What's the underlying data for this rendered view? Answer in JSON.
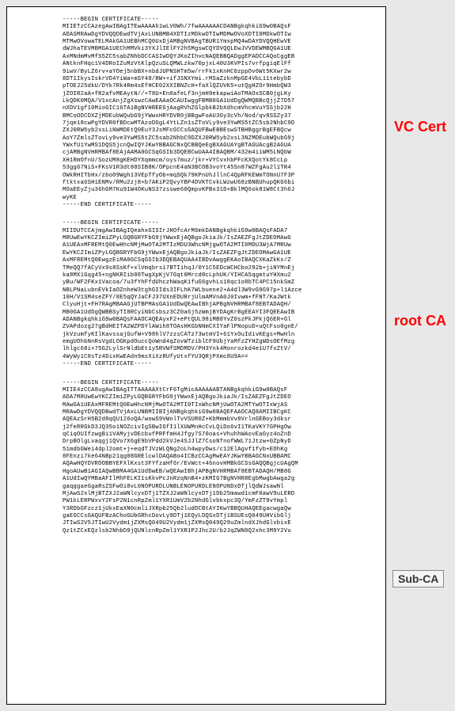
{
  "labels": {
    "vc": "VC Cert",
    "root": "root CA",
    "sub": "Sub-CA"
  },
  "certs": {
    "block1": "-----BEGIN CERTIFICATE-----\nMIIETzCCAzegAwIBAgITEwAAAAh1wLV0Wh/7fwAAAAAACDANBgkqhkiG9w0BAQsF\nADASMRAwDgYDVQQDEwdTVjAxLUNBMB4XDTIzMDkwOTIwMDMwOVoXDTI0MDkwOTIw\nMTMwOVowaTELMAkGA1UEBhMCQ0UxDjAMBgNVBAgTBUR1YmxpMQ4wDAYDVQQHEwVE\ndWJhaTEVMBMGA1UEChMMVki3YXJlIElFY2h5MgswCQYDVQQLEwJVVDEWMBQGA1UE\nAxMNdmMvMfS5ZC5sabZNhbDCCASIwDQYJKoZIhvcNAQEBBQADggEPADCCAQoCggEB\nANtknFHqc1V4DRoIZuMzVtKlpQzuSLQMWLzkw70pjxL40U3KVPIs7vrfpgiqElFf\n9iwV/ByLZ6rv+aYOej5nbBX+nbdJUPNSHTm5w/rrFk1xKnHC0zppOv6Wt5KXwr2w\n8DT1IkysIskrVD4YiWa+mSY48/RW++ifJSNXYmi.rMSaZzknMpGE4VbL11tebybD\npTOEJ25dkU/DYk7Rk4Rm4sEfHCE02XXIBNZcH+faXlQZUVK5+utQgHZOr9HmbQW3\njZOIR2aA+fR2afvMEAytN//+T8U+En0afeLf3njmH9ekapwiAoTMAOxSCB0jgLKy\nLkQDK0MQA/V1xcAnjZgXswzCAwEAAaOCAUIwggFBMB0GA1UdDgQWMQBBcQjjZ7D57\nnXDV1gf10MioGIC16TA1BgNVHREEGjAagRVhZGlpbkB2bXdhcmVhcmVuYSSjb22H\nBMCoODCDXZjMDEubWQubG9jYWwxHRYDVR0jBBgwFoAU3Gy3cVh/Nod/qv8SSZy37\n7jqe18cwPgYDVR0fBDcwMTAzoDGgL4YtLZn1sZToVLy9ve3YwMS5tZC5sb2NhbC9D\nZXJ0RW5yb2xsLiNWMDEtQ0EuY3JsMFcGCCsGAQUFBwEBBEswSTBHBggrBgEFBQcw\nAoY7ZmlsZTovLy9ve3YwMS5tZC5sab2NhbC9DZXJ0RW5yb2xsL3NZMDEubWQubG9j\nYWxfU1YwMS1DQS5jcnQwIQYJKwYBBAGCNxQCBBQeEgBXAGUAYgBTAGUAcgB2AGUA\ncjAMBgNVHRMBAf8EAjAAMA0GCSqGSIb3DQEBCwUAA4IBAQBM/432m4iiWM5LNQbW\nXH1RmOfnU/SozUM8gKEHDYXqmmcm/oys7muz/jkr+VYCvxhbPFcKXQotYk8CcLp\n53gg67NiS+FKsV1R3dt80SIB8K/OPpcnE4aN3BCOB3voYt45Sn87WZFgAu2l1TR4\nOWkRHITbHx/zboO9Wgh13VEpTfyOb+mqSQk79KPnUhJllnC4QpRFKEWmTONnU7F3P\nftktxa6SH1ENMv/RMu2zj8+b7AKiP2QvyYBP4DVKTCvkLWzwU68zBNBUhupQKG6bi\nMOaEEyZju36hGM7Ku91W4OKuNS37zsswe60QmpvKPBx31D+BklMQ6ok81W8Ct3h6J\nwyKE\n-----END CERTIFICATE-----",
    "block2": "-----BEGIN CERTIFICATE-----\nMIIDUTCCAjmgAwIBAgIQeahxGISIrJHOfcArM6mkDANBgkqhkiG9w0BAQsFADA7\nMRUwEwYKCZImiZPyLGQBGRYFbG9jYWwxEjAQBgoJkiaJk/IsZAEZFgJtZDEOMAwG\nA1UEAxMFREMtQ0EwHhcNMjMwOTA2MTIzMDU3WhcNMjgwOTA2MTI0MDU3WjA7MRUw\nEwYKCZImiZPyLGQBGRYFbG9jYWwxEjAQBgoJkiaJk/IsZAEZFgJtZDEOMAwGA1UE\nAxMFREMtQ0EwgzEiMA0GCSqGSIb3DQEBAQUAA4IBDvAwggEKAoIBAQCXKaZkKx/Z\nTMeQQ7fACyVx9s8SsKf+xlVmqbrsi7BTIihqJ/0Y1C5EDcWCHCbo292b+jiNYMnEj\nka8MX1Gqg45+ngNKRIib08TwgXpKjV7Gqt0Mrcd8cLphUK/YIHCA5qgmtuYHXmu2\nyBu/WF2FKx1Vacoa/7u3fYhFfdUhczhWaqK1fuG6gvhLs18qc1o8bTC4PC15nkSmZ\nNBLPNaLubnEVkIaOZnheW3tghGIIds3IFLhK7WLbuene2+A4dl3W9vG9G97p+l1Azce\n10H/V1SM4seZFY/8E5qQYJaCFJ37UXnEDURrjUlmAMVnA0J0Ivwm+fFNT/KaJWtk\nClyuHjt+FH7RAgMBAAGjUTBPMAsGA1UdDwQEAwIBhjAPBgNVHRMBAf8EBTADAQH/\nMB0GA1UdDgQWBBSyTI8RCyiNbCsbsz3CZ0a6j5zWmjBYDAgKrBgEEAYI3FQEEAwIB\nADANBgkqhkiG9w0BAQsFAAOCAQEAyxF2+ePtQUL98iMB8YvZ0szPkJPkjQ6ER+Gl\nZVAPdozg27gBdHEITA2WZPDYlAWih8TOAsHKGbNNmCXIYaFlPNopuD+uQtFso0gnE/\njkVzumfyKIlKavssajGufW+V98hlV7zzsCATz73wtmVI+61YxOuIdivKEgs+MwHln\nemgUOhbNnRsVgdLOGKpdOuccQoWnd4qZovWTziblCF9UbjYaMfzZYHZgWDsOEfMzg\nlhlgc68i+75G2LylSrNldbEt1y5RVWfSMDMDV/PH3Ynk4Monrozkd4e1U7fxZtV/\n4WyWy1C8sTz4DixKwEAdn9msXiXzRUfyUtxfYU3QRjPXmc8U9A==\n-----END CERTIFICATE-----",
    "block3": "-----BEGIN CERTIFICATE-----\nMIIE4zCCA8ugAwIBAgITTAAAAAXtCrF6TgMicAAAAAABTANBgkqhkiG9w0BAQsF\nADA7MRUwEwYKCZImiZPyLGQBGRYFbG9jYWwxEjAQBgoJkiaJk/IsZAEZFgJtZDEO\nMAwGA1UEAxMFREMtQ0EwHhcNMjMwOTA2MTI0TIxWhcNMjUwOTA2MTYwOTIxWjAS\nMRAwDgYDVQQDBwdTVjAxLUNBMIIBIjANBgkqhkiG9w0BAQEFAAOCAQ8AMIIBCgKC\nAQEAzSrH5B2d8qQU126oQA/wowS9VWnlTvVSUR0Z+KbMmmbVv8VrlnGEBoy3dksr\nj2feRRGkD3JQ35o1NOZcivIgSBwIGfI1lXUWMnHcCvLQiDo6vI1TKaVKY7GPHgOw\nqCiqOUIfzwgBi1VAMyjvDEcbufPRFfmH4Jfgy7S70oas+VhuhhWAovEaGyz4oZnD\nDrpBOlgLvaqgj1QVo7X6gE9bVPdd2kVJe4SJJlZ7CsoNTnofWWL71Jtzw+0ZpNyD\n51mdbGWei4dpl2omt+j+eqdTJVzWLQNg2oLh4wpyDws/c12ElAgvf1fyb+EOhKg\n8FEnzi7ke64NBp21qg08GRElcwlDAQABo4ICBzCCAgMwEAYJKwYBBAGCNxUBBAMC\nAQAwHQYDVROOBBYEFXlKxst3FYfzaHf6r/EvWct+46novHMBkGCSsGAQQBgjcUAgQM\nHgoAUwB1AGIAQwBBMA4GA1UdDwEB/wQEAwIBhjAPBgNVHRMBAf8EBTADAQH/MB8G\nA1UdIwQYMBaAFIlMhFELKI1sKkvPcJnRzqNnB4+zKMIG7BgNVHR8EgbMwgbAwga2g\ngaqggaeGgaRsZSFwOi8vL0NOPURDLUNBLENOPURDLENOPUNDxDTjlQdWJsawNl\nMjAwS2xlMjBTZXJ2aWNlcyxDTj1TZXJ2aWNlcyxDTj1Db25mawd1cmF0awV9uLERD\nPW1kLERPWxvY2FsP2N1cnRpZml1YXR1UmV2b2NhdGlvbkxpc3Q/YmFzZT9vYmpl\nY3RDbGFzcz1jUkxEaXN0cmliJXRpb25Qb2ludDCBtAYIKwYBBQUHAQEEgacwgaQw\ngaEGCCsGAQUFBzAChoGUbGRhcDovLy9DTj1EQyLDQSxDTj1BSUEsQ049UHVibGlj\nJTIwS2V5JTIwU2Vydm1jZXMsQ049U2Vydm1jZXMsQ049Q29uZmlndXJhdGlvbixE\nQz1tZCxEQzlsb2NhbD9jQUNlcnRpZml1YXR1P2Jhc2U/b2JqZWN0Q2xhc3M9Y2Vu"
  }
}
